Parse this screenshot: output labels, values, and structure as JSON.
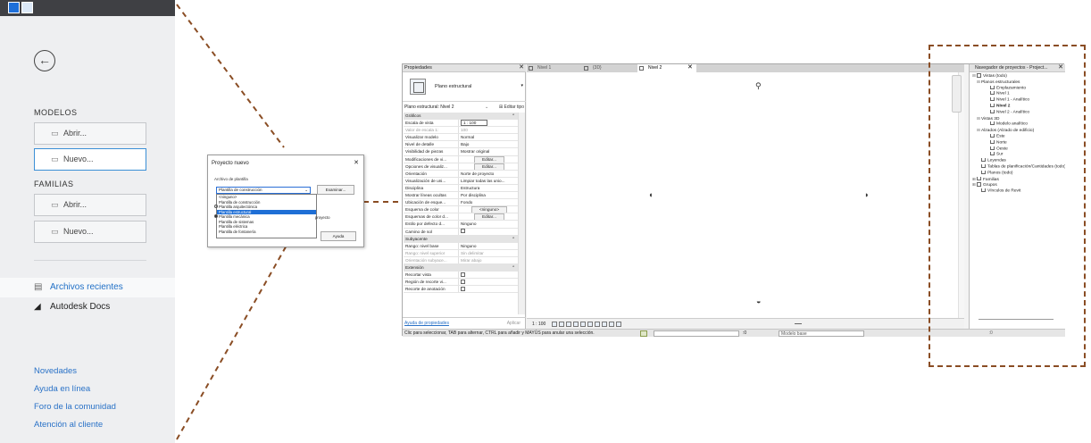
{
  "home": {
    "back_icon": "back-arrow-circle-icon",
    "models_label": "MODELOS",
    "models_open": "Abrir...",
    "models_new": "Nuevo...",
    "families_label": "FAMILIAS",
    "families_open": "Abrir...",
    "families_new": "Nuevo...",
    "recent_files": "Archivos recientes",
    "autodesk_docs": "Autodesk Docs",
    "links": [
      "Novedades",
      "Ayuda en línea",
      "Foro de la comunidad",
      "Atención al cliente"
    ]
  },
  "dialog": {
    "title": "Proyecto nuevo",
    "group_label": "Archivo de plantilla",
    "selected": "Plantilla de construcción",
    "browse": "Examinar...",
    "options": [
      "<ninguno>",
      "Plantilla de construcción",
      "Plantilla arquitectónica",
      "Plantilla estructural",
      "Plantilla mecánica",
      "Plantilla de sistemas",
      "Plantilla eléctrica",
      "Plantilla de fontanería"
    ],
    "selected_index": 3,
    "side_text": "proyecto",
    "help": "Ayuda"
  },
  "properties": {
    "title": "Propiedades",
    "type_name": "Plano estructural",
    "instance": "Plano estructural: Nivel 2",
    "edit_type": "Editar tipo",
    "rows": [
      {
        "k": "Gráficos",
        "group": true
      },
      {
        "k": "Escala de vista",
        "v": "1 : 100",
        "hl": true
      },
      {
        "k": "Valor de escala    1:",
        "v": "100",
        "dim": true
      },
      {
        "k": "Visualizar modelo",
        "v": "Normal"
      },
      {
        "k": "Nivel de detalle",
        "v": "Bajo"
      },
      {
        "k": "Visibilidad de piezas",
        "v": "Mostrar original"
      },
      {
        "k": "Modificaciones de vi...",
        "v": "Editar...",
        "btn": true
      },
      {
        "k": "Opciones de visualiz...",
        "v": "Editar...",
        "btn": true
      },
      {
        "k": "Orientación",
        "v": "Norte de proyecto"
      },
      {
        "k": "Visualización de uni...",
        "v": "Limpiar todas las unio..."
      },
      {
        "k": "Disciplina",
        "v": "Estructura"
      },
      {
        "k": "Mostrar líneas ocultas",
        "v": "Por disciplina"
      },
      {
        "k": "Ubicación de esque...",
        "v": "Fondo"
      },
      {
        "k": "Esquema de color",
        "v": "<ninguno>",
        "btn": true
      },
      {
        "k": "Esquemas de color d...",
        "v": "Editar...",
        "btn": true
      },
      {
        "k": "Estilo por defecto d...",
        "v": "Ninguno"
      },
      {
        "k": "Camino de sol",
        "v": "",
        "chk": true
      },
      {
        "k": "Subyacente",
        "group": true
      },
      {
        "k": "Rango: nivel base",
        "v": "Ninguno"
      },
      {
        "k": "Rango: nivel superior",
        "v": "Sin delimitar",
        "dim": true
      },
      {
        "k": "Orientación subyace...",
        "v": "Mirar abajo",
        "dim": true
      },
      {
        "k": "Extensión",
        "group": true
      },
      {
        "k": "Recortar vista",
        "v": "",
        "chk": true
      },
      {
        "k": "Región de recorte vi...",
        "v": "",
        "chk": true
      },
      {
        "k": "Recorte de anotación",
        "v": "",
        "chk": true
      }
    ],
    "help_link": "Ayuda de propiedades",
    "apply": "Aplicar"
  },
  "tabs": [
    {
      "label": "Nivel 1",
      "active": false
    },
    {
      "label": "{3D}",
      "active": false
    },
    {
      "label": "Nivel 2",
      "active": true
    }
  ],
  "view": {
    "scale": "1 : 100"
  },
  "browser": {
    "title": "Navegador de proyectos - Project...",
    "tree": [
      {
        "t": "Vistas (todo)",
        "lvl": 0,
        "tg": "⊟",
        "sq": true
      },
      {
        "t": "Planos estructurales",
        "lvl": 1,
        "tg": "⊟"
      },
      {
        "t": "Emplazamiento",
        "lvl": 3,
        "sq": true
      },
      {
        "t": "Nivel 1",
        "lvl": 3,
        "sq": true
      },
      {
        "t": "Nivel 1 - Analítico",
        "lvl": 3,
        "sq": true
      },
      {
        "t": "Nivel 2",
        "lvl": 3,
        "sq": true,
        "bold": true
      },
      {
        "t": "Nivel 2 - Analítico",
        "lvl": 3,
        "sq": true
      },
      {
        "t": "Vistas 3D",
        "lvl": 1,
        "tg": "⊟"
      },
      {
        "t": "Modelo analítico",
        "lvl": 3,
        "sq": true
      },
      {
        "t": "Alzados (Alzado de edificio)",
        "lvl": 1,
        "tg": "⊟"
      },
      {
        "t": "Este",
        "lvl": 3,
        "sq": true
      },
      {
        "t": "Norte",
        "lvl": 3,
        "sq": true
      },
      {
        "t": "Oeste",
        "lvl": 3,
        "sq": true
      },
      {
        "t": "Sur",
        "lvl": 3,
        "sq": true
      },
      {
        "t": "Leyendas",
        "lvl": 1,
        "sq": true
      },
      {
        "t": "Tablas de planificación/Cantidades (todo)",
        "lvl": 1,
        "sq": true
      },
      {
        "t": "Planos (todo)",
        "lvl": 1,
        "sq": true
      },
      {
        "t": "Familias",
        "lvl": 0,
        "tg": "⊞",
        "sq": true
      },
      {
        "t": "Grupos",
        "lvl": 0,
        "tg": "⊞",
        "sq": true
      },
      {
        "t": "Vínculos de Revit",
        "lvl": 1,
        "sq": true
      }
    ]
  },
  "status": {
    "message": "Clic para seleccionar, TAB para alternar, CTRL para añadir y MAYÚS para anular una selección.",
    "zero": ":0",
    "model_base": "Modelo base",
    "right": "            :0"
  },
  "colors": {
    "callout": "#8a4d24",
    "accent": "#1f6fc6",
    "selection": "#1f6fd6"
  }
}
